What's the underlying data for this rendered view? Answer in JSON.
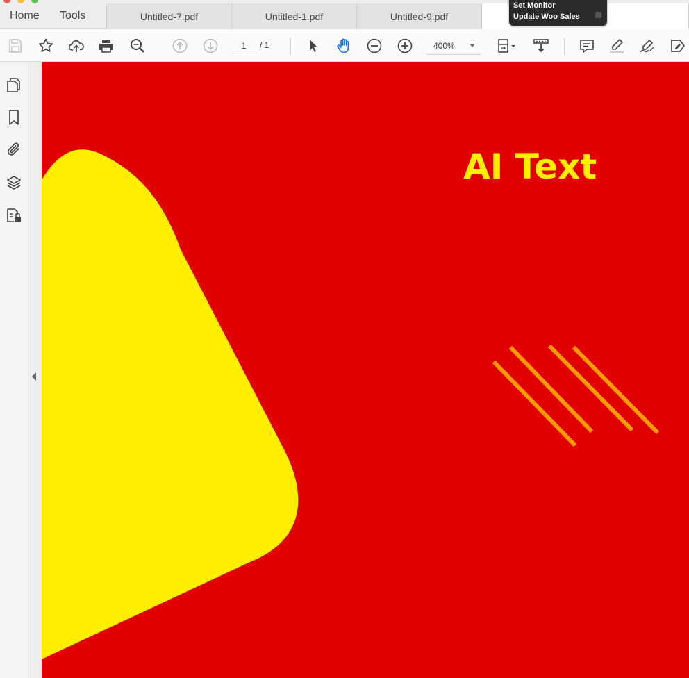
{
  "tabbar": {
    "home_label": "Home",
    "tools_label": "Tools",
    "tabs": [
      {
        "label": "Untitled-7.pdf"
      },
      {
        "label": "Untitled-1.pdf"
      },
      {
        "label": "Untitled-9.pdf"
      },
      {
        "label": ""
      }
    ]
  },
  "notification": {
    "line1": "Set Monitor",
    "line2": "Update Woo Sales"
  },
  "toolbar": {
    "icons": [
      "save-icon",
      "star-icon",
      "cloud-upload-icon",
      "print-icon",
      "zoom-search-icon",
      "page-up-icon",
      "page-down-icon",
      "select-arrow-icon",
      "hand-tool-icon",
      "zoom-out-icon",
      "zoom-in-icon",
      "page-fit-icon",
      "scroll-mode-icon",
      "comment-icon",
      "highlight-icon",
      "sign-icon",
      "fill-sign-icon"
    ],
    "page_current": "1",
    "page_total": "/ 1",
    "zoom": "400%"
  },
  "sidebar": {
    "icons": [
      "pages-icon",
      "bookmark-icon",
      "attachment-icon",
      "layers-icon",
      "security-icon"
    ]
  },
  "document": {
    "text": "AI Text",
    "colors": {
      "background": "#e00000",
      "accent": "#ffee00",
      "stripe": "#ff9900"
    }
  },
  "colors": {
    "hand_tool_active": "#1473e6"
  }
}
